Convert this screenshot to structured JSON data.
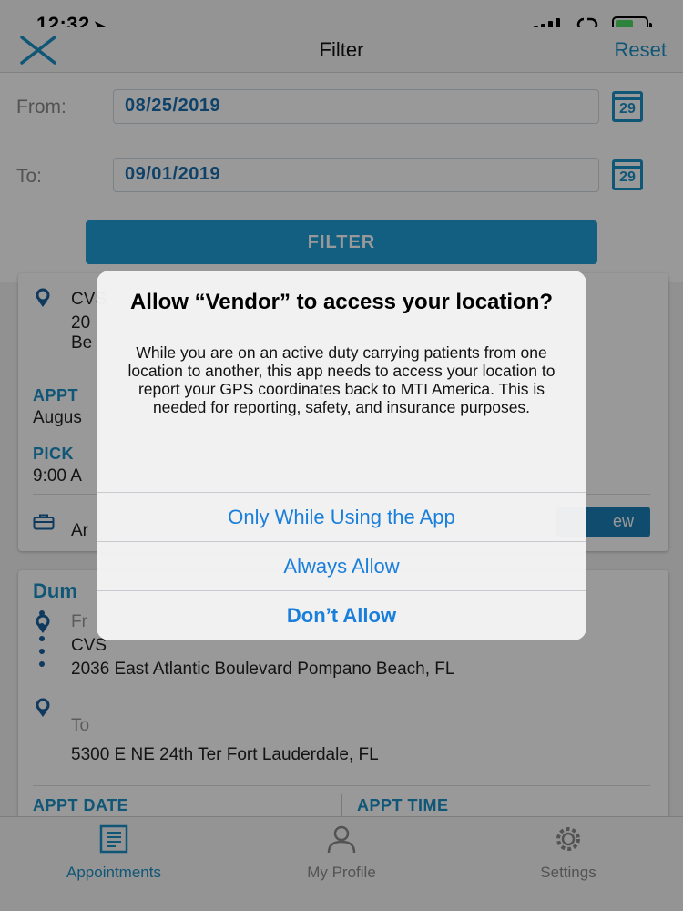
{
  "status_bar": {
    "time": "12:32",
    "location_glyph": "➤"
  },
  "header": {
    "title": "Filter",
    "reset_label": "Reset"
  },
  "filter": {
    "from_label": "From:",
    "from_value": "08/25/2019",
    "to_label": "To:",
    "to_value": "09/01/2019",
    "calendar_day": "29",
    "button_label": "FILTER"
  },
  "card1": {
    "pickup_name": "CVS",
    "pickup_line1": "20",
    "pickup_line2": "Be",
    "appt_label": "APPT",
    "appt_value": "Augus",
    "pick_label": "PICK",
    "pick_value": "9:00 A",
    "footer_text": "Ar",
    "view_label": "ew"
  },
  "card2": {
    "patient_name": "Dum",
    "from_label": "Fr",
    "pickup_name": "CVS",
    "pickup_address": "2036 East Atlantic Boulevard Pompano Beach, FL",
    "to_label": "To",
    "dropoff_address": "5300 E NE 24th Ter Fort Lauderdale, FL",
    "appt_date_label": "APPT DATE",
    "appt_time_label": "APPT TIME"
  },
  "tabs": [
    {
      "label": "Appointments",
      "icon": "document-icon"
    },
    {
      "label": "My Profile",
      "icon": "person-icon"
    },
    {
      "label": "Settings",
      "icon": "gear-icon"
    }
  ],
  "alert": {
    "title": "Allow “Vendor” to access your location?",
    "message": "While you are on an active duty carrying patients from one location to another, this app needs to access your location to report your GPS coordinates back to MTI America. This is needed for reporting, safety, and insurance purposes.",
    "options": [
      "Only While Using the App",
      "Always Allow",
      "Don’t Allow"
    ]
  },
  "colors": {
    "accent": "#1a8fc7",
    "ios_blue": "#1a7fdb",
    "button": "#1f9ed9"
  }
}
